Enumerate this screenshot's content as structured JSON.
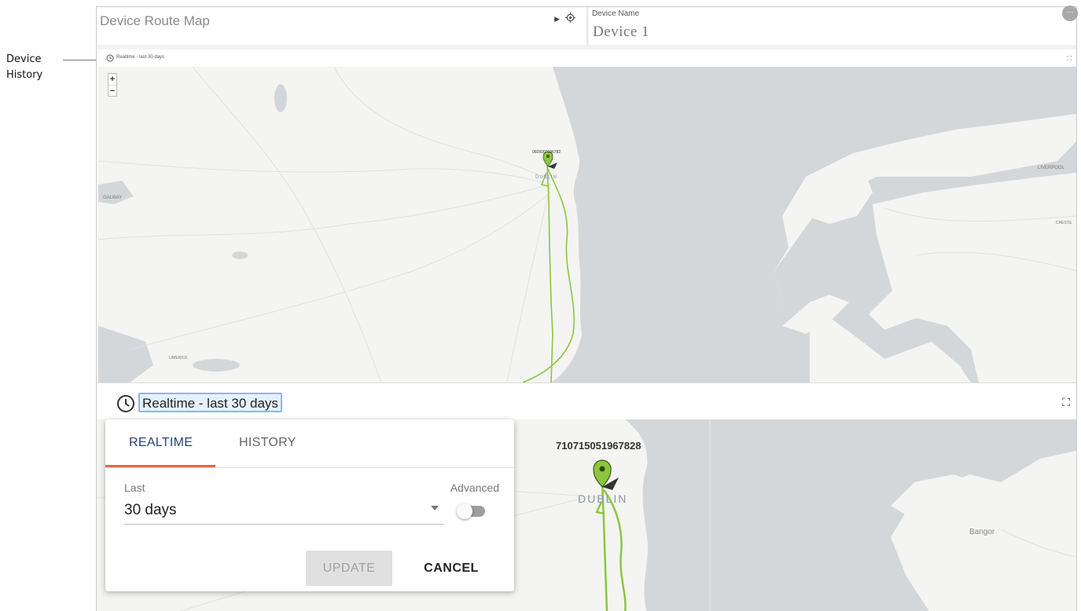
{
  "annotation": {
    "line1": "Device",
    "line2": "History"
  },
  "title_card": {
    "title": "Device Route Map"
  },
  "device_card": {
    "label": "Device Name",
    "name": "Device 1",
    "more_icon": "more-dots-icon"
  },
  "small_map": {
    "range_text": "Realtime - last 30 days",
    "zoom_in": "+",
    "zoom_out": "−",
    "device_id": "0605007196782",
    "places": {
      "dublin": "DUBLIN",
      "galway": "GALWAY",
      "limerick": "LIMERICK",
      "liverpool": "LIVERPOOL",
      "chester": "CHESTE"
    }
  },
  "big_map": {
    "range_text": "Realtime - last 30 days",
    "device_id": "710715051967828",
    "places": {
      "dublin": "DUBLIN",
      "bangor": "Bangor"
    }
  },
  "popup": {
    "tabs": [
      {
        "label": "REALTIME",
        "active": true
      },
      {
        "label": "HISTORY",
        "active": false
      }
    ],
    "last_label": "Last",
    "last_value": "30 days",
    "advanced_label": "Advanced",
    "advanced_on": false,
    "update_label": "UPDATE",
    "cancel_label": "CANCEL"
  },
  "colors": {
    "route": "#8cc63f",
    "sea": "#d4d7da",
    "land": "#f4f4f2",
    "tab_ink": "#e8673a",
    "tab_active": "#27427a"
  }
}
